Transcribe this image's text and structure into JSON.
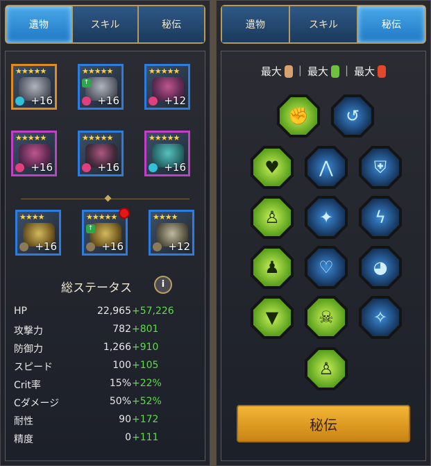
{
  "left": {
    "tabs": [
      "遺物",
      "スキル",
      "秘伝"
    ],
    "active_tab": 0,
    "gear": [
      {
        "level": "+16",
        "stars": "★★★★★"
      },
      {
        "level": "+16",
        "stars": "★★★★★"
      },
      {
        "level": "+12",
        "stars": "★★★★★"
      },
      {
        "level": "+16",
        "stars": "★★★★★"
      },
      {
        "level": "+16",
        "stars": "★★★★★"
      },
      {
        "level": "+16",
        "stars": "★★★★★"
      }
    ],
    "accessories": [
      {
        "level": "+16",
        "stars": "★★★★"
      },
      {
        "level": "+16",
        "stars": "★★★★★"
      },
      {
        "level": "+12",
        "stars": "★★★★"
      }
    ],
    "stats_title": "総ステータス",
    "info_icon": "i",
    "stats": [
      {
        "name": "HP",
        "value": "22,965",
        "bonus": "+57,226"
      },
      {
        "name": "攻撃力",
        "value": "782",
        "bonus": "+801"
      },
      {
        "name": "防御力",
        "value": "1,266",
        "bonus": "+910"
      },
      {
        "name": "スピード",
        "value": "100",
        "bonus": "+105"
      },
      {
        "name": "Crit率",
        "value": "15%",
        "bonus": "+22%"
      },
      {
        "name": "Cダメージ",
        "value": "50%",
        "bonus": "+52%"
      },
      {
        "name": "耐性",
        "value": "90",
        "bonus": "+172"
      },
      {
        "name": "精度",
        "value": "0",
        "bonus": "+111"
      }
    ]
  },
  "right": {
    "tabs": [
      "遺物",
      "スキル",
      "秘伝"
    ],
    "active_tab": 2,
    "max_labels": [
      "最大",
      "最大",
      "最大"
    ],
    "potion_colors": [
      "#d9a070",
      "#6fc040",
      "#e04a2a"
    ],
    "nodes_icons": [
      "fist-icon",
      "swirl-icon",
      "heart-shield-icon",
      "pray-hands-icon",
      "shield-icon",
      "walking-figure-icon",
      "person-sparkle-icon",
      "lightning-icon",
      "crowd-icon",
      "chain-heart-icon",
      "angry-eyes-icon",
      "claws-icon",
      "skull-icon",
      "star-compass-icon",
      "strongman-icon"
    ],
    "button_label": "秘伝"
  },
  "colors": {
    "accent_gold": "#b89a5a",
    "tab_active": "#1f77c4",
    "bonus_green": "#5edc4a",
    "button_gold": "#f3b636"
  }
}
